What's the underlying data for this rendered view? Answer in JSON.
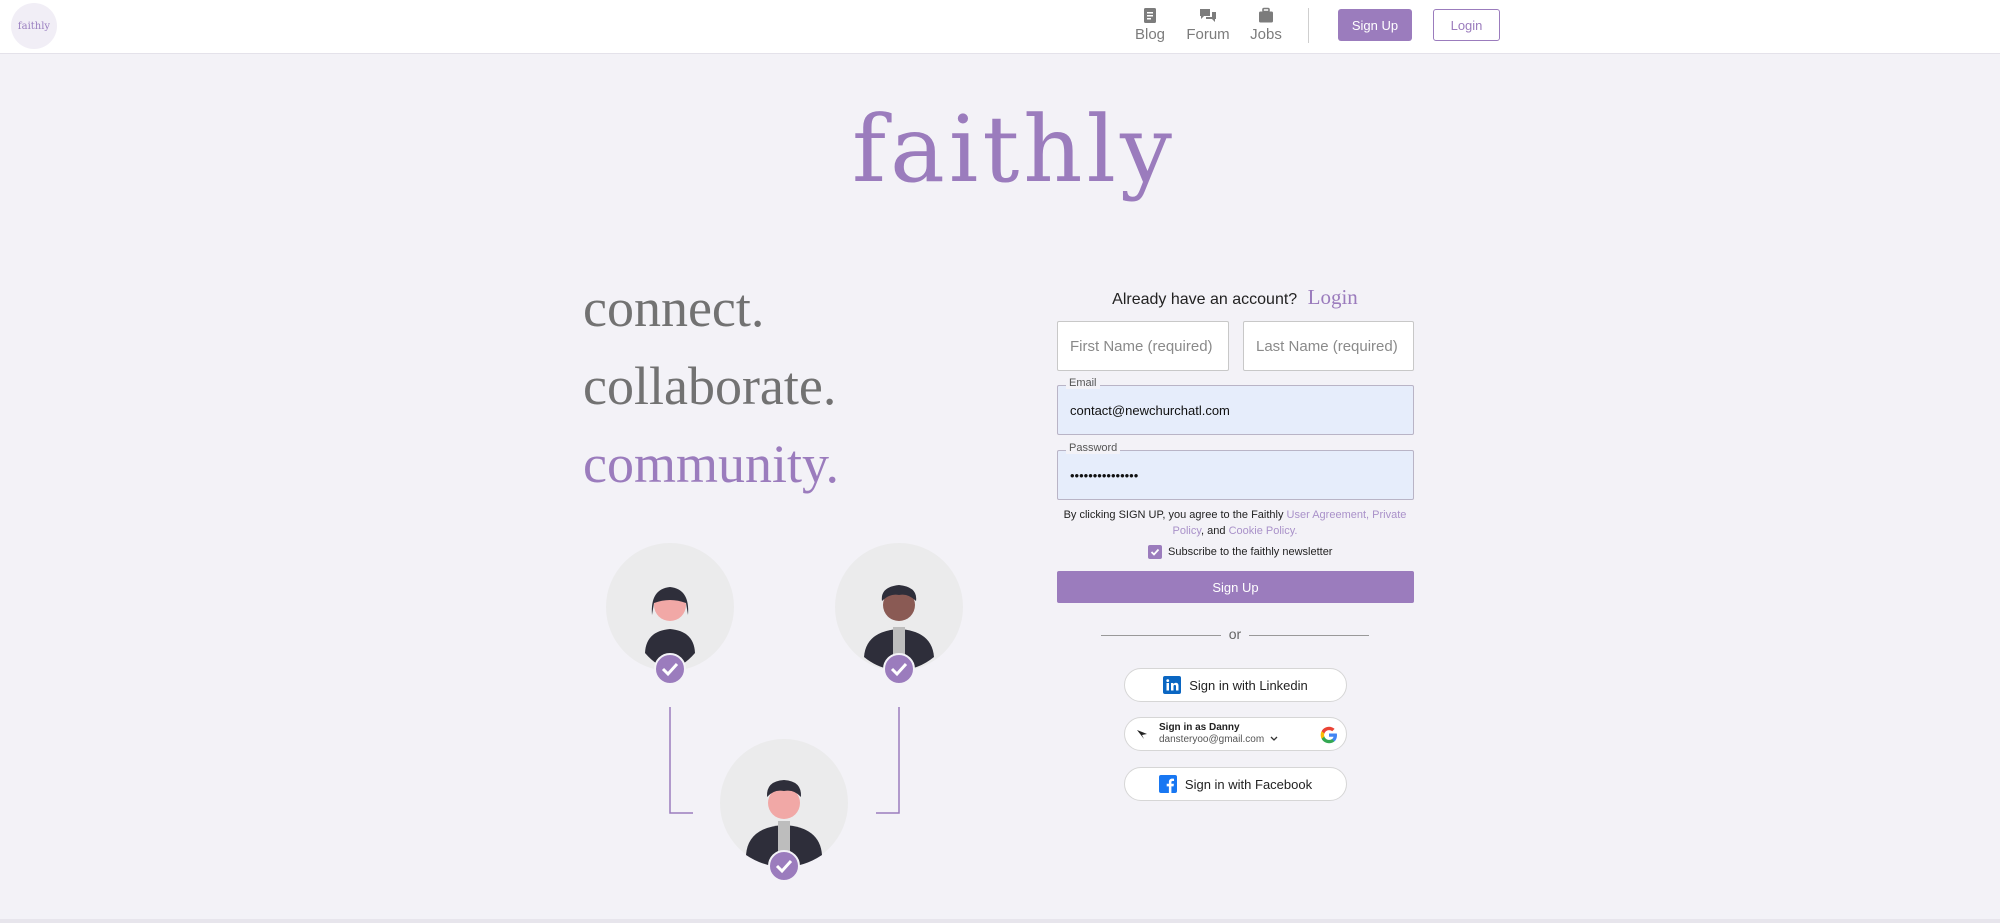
{
  "brand": {
    "mini_logo_text": "faithly",
    "logo_text": "faithly",
    "accent_color": "#9b7cbd"
  },
  "nav": {
    "items": [
      {
        "label": "Blog",
        "icon": "document-icon"
      },
      {
        "label": "Forum",
        "icon": "chat-icon"
      },
      {
        "label": "Jobs",
        "icon": "briefcase-icon"
      }
    ],
    "signup_label": "Sign Up",
    "login_label": "Login"
  },
  "taglines": [
    "connect.",
    "collaborate.",
    "community."
  ],
  "form": {
    "already_text": "Already have an account?",
    "login_link": "Login",
    "first_name_placeholder": "First Name (required)",
    "last_name_placeholder": "Last Name (required)",
    "email_label": "Email",
    "email_value": "contact@newchurchatl.com",
    "password_label": "Password",
    "password_value": "•••••••••••••••",
    "terms_prefix": "By clicking SIGN UP, you agree to the Faithly",
    "terms_user_agreement": "User Agreement,",
    "terms_privacy": "Private Policy",
    "terms_and": ", and",
    "terms_cookie": "Cookie Policy.",
    "newsletter_label": "Subscribe to the faithly newsletter",
    "newsletter_checked": true,
    "signup_button": "Sign Up",
    "or_text": "or"
  },
  "social": {
    "linkedin_label": "Sign in with Linkedin",
    "google_name": "Sign in as Danny",
    "google_email": "dansteryoo@gmail.com",
    "facebook_label": "Sign in with Facebook"
  }
}
